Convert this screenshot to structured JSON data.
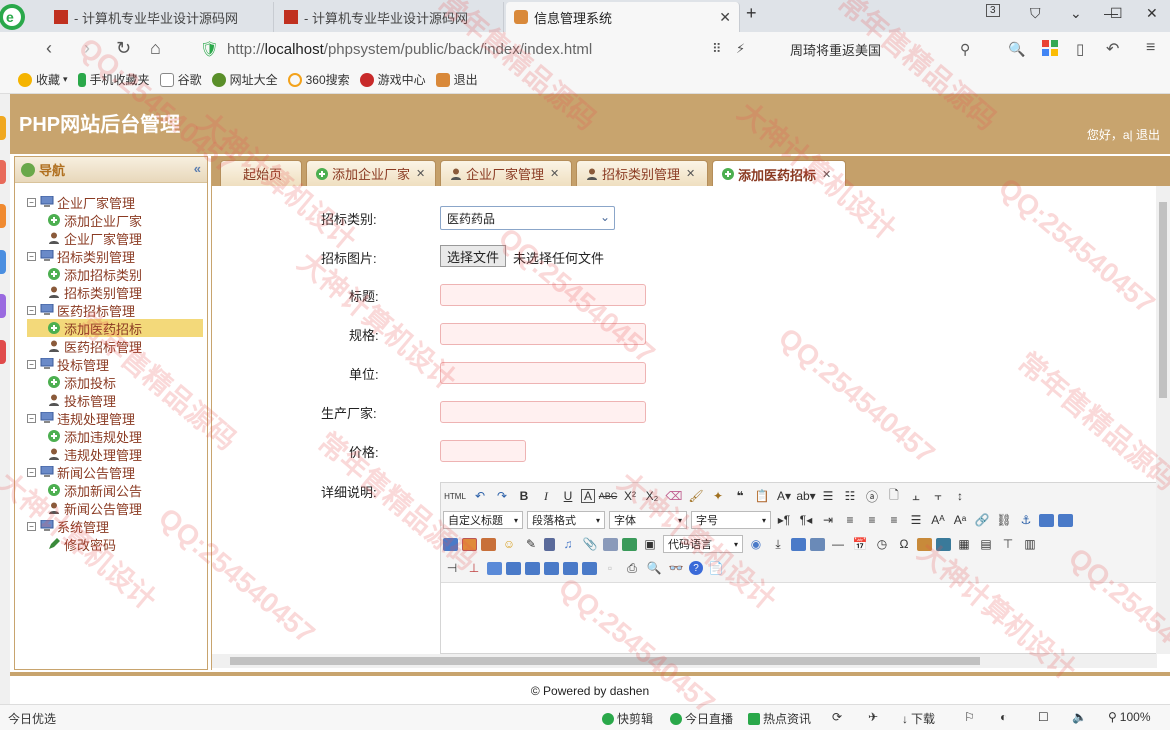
{
  "browser": {
    "tabs": [
      {
        "label": "- 计算机专业毕业设计源码网"
      },
      {
        "label": "- 计算机专业毕业设计源码网"
      },
      {
        "label": "信息管理系统"
      }
    ],
    "tab_count": "3",
    "url_scheme": "http://",
    "url_host": "localhost",
    "url_path": "/phpsystem/public/back/index/index.html",
    "search_text": "周琦将重返美国",
    "bookmarks": [
      "收藏",
      "手机收藏夹",
      "谷歌",
      "网址大全",
      "360搜索",
      "游戏中心",
      "退出"
    ]
  },
  "app": {
    "title": "PHP网站后台管理",
    "user_text": "您好，a| 退出",
    "footer": "© Powered by dashen"
  },
  "sidebar": {
    "title": "导航",
    "collapse": "«",
    "groups": [
      {
        "label": "企业厂家管理",
        "children": [
          "添加企业厂家",
          "企业厂家管理"
        ]
      },
      {
        "label": "招标类别管理",
        "children": [
          "添加招标类别",
          "招标类别管理"
        ]
      },
      {
        "label": "医药招标管理",
        "children": [
          "添加医药招标",
          "医药招标管理"
        ]
      },
      {
        "label": "投标管理",
        "children": [
          "添加投标",
          "投标管理"
        ]
      },
      {
        "label": "违规处理管理",
        "children": [
          "添加违规处理",
          "违规处理管理"
        ]
      },
      {
        "label": "新闻公告管理",
        "children": [
          "添加新闻公告",
          "新闻公告管理"
        ]
      },
      {
        "label": "系统管理",
        "children": [
          "修改密码"
        ]
      }
    ]
  },
  "content_tabs": [
    {
      "label": "起始页"
    },
    {
      "label": "添加企业厂家"
    },
    {
      "label": "企业厂家管理"
    },
    {
      "label": "招标类别管理"
    },
    {
      "label": "添加医药招标"
    }
  ],
  "form": {
    "category_label": "招标类别:",
    "category_value": "医药药品",
    "image_label": "招标图片:",
    "file_button": "选择文件",
    "file_status": "未选择任何文件",
    "title_label": "标题:",
    "spec_label": "规格:",
    "unit_label": "单位:",
    "maker_label": "生产厂家:",
    "price_label": "价格:",
    "detail_label": "详细说明:"
  },
  "editor": {
    "html_label": "HTML",
    "heading_select": "自定义标题",
    "paragraph_select": "段落格式",
    "font_select": "字体",
    "size_select": "字号",
    "code_select": "代码语言"
  },
  "statusbar": {
    "left": "今日优选",
    "items": [
      "快剪辑",
      "今日直播",
      "热点资讯",
      "下载",
      "100%"
    ]
  },
  "watermark": {
    "texts": [
      "QQ:254540457",
      "大神计算机设计",
      "常年售精品源码"
    ]
  }
}
